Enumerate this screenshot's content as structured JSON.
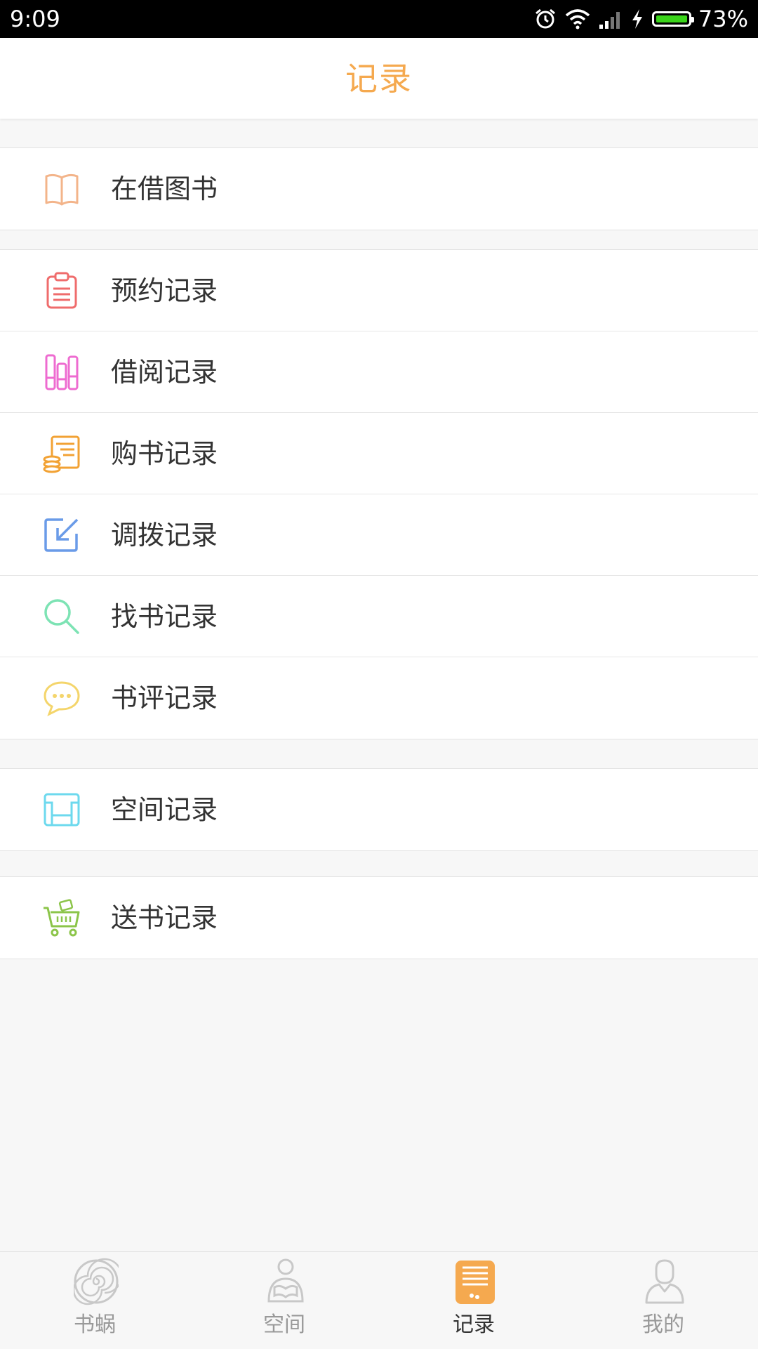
{
  "status_bar": {
    "time": "9:09",
    "battery_percent": "73%",
    "battery_level": 0.73,
    "icons": [
      "alarm-icon",
      "wifi-icon",
      "signal-icon",
      "charging-icon",
      "battery-icon"
    ]
  },
  "header": {
    "title": "记录"
  },
  "colors": {
    "accent": "#f5a94f",
    "book": "#f3b48a",
    "reserve": "#ef6c6c",
    "borrow": "#ee6bd0",
    "purchase": "#f2a234",
    "transfer": "#6a9be8",
    "find": "#7de3b4",
    "review": "#f4d56b",
    "space": "#6dd9ee",
    "gift": "#8cc54a",
    "battery_fill": "#3ad41a"
  },
  "menu": {
    "borrowed_books": "在借图书",
    "reservation_records": "预约记录",
    "borrowing_records": "借阅记录",
    "purchase_records": "购书记录",
    "transfer_records": "调拨记录",
    "search_records": "找书记录",
    "review_records": "书评记录",
    "space_records": "空间记录",
    "gift_records": "送书记录"
  },
  "bottom_nav": {
    "items": [
      {
        "label": "书蜗",
        "icon": "snail-shell-icon",
        "active": false
      },
      {
        "label": "空间",
        "icon": "reading-person-icon",
        "active": false
      },
      {
        "label": "记录",
        "icon": "record-note-icon",
        "active": true
      },
      {
        "label": "我的",
        "icon": "profile-icon",
        "active": false
      }
    ]
  }
}
